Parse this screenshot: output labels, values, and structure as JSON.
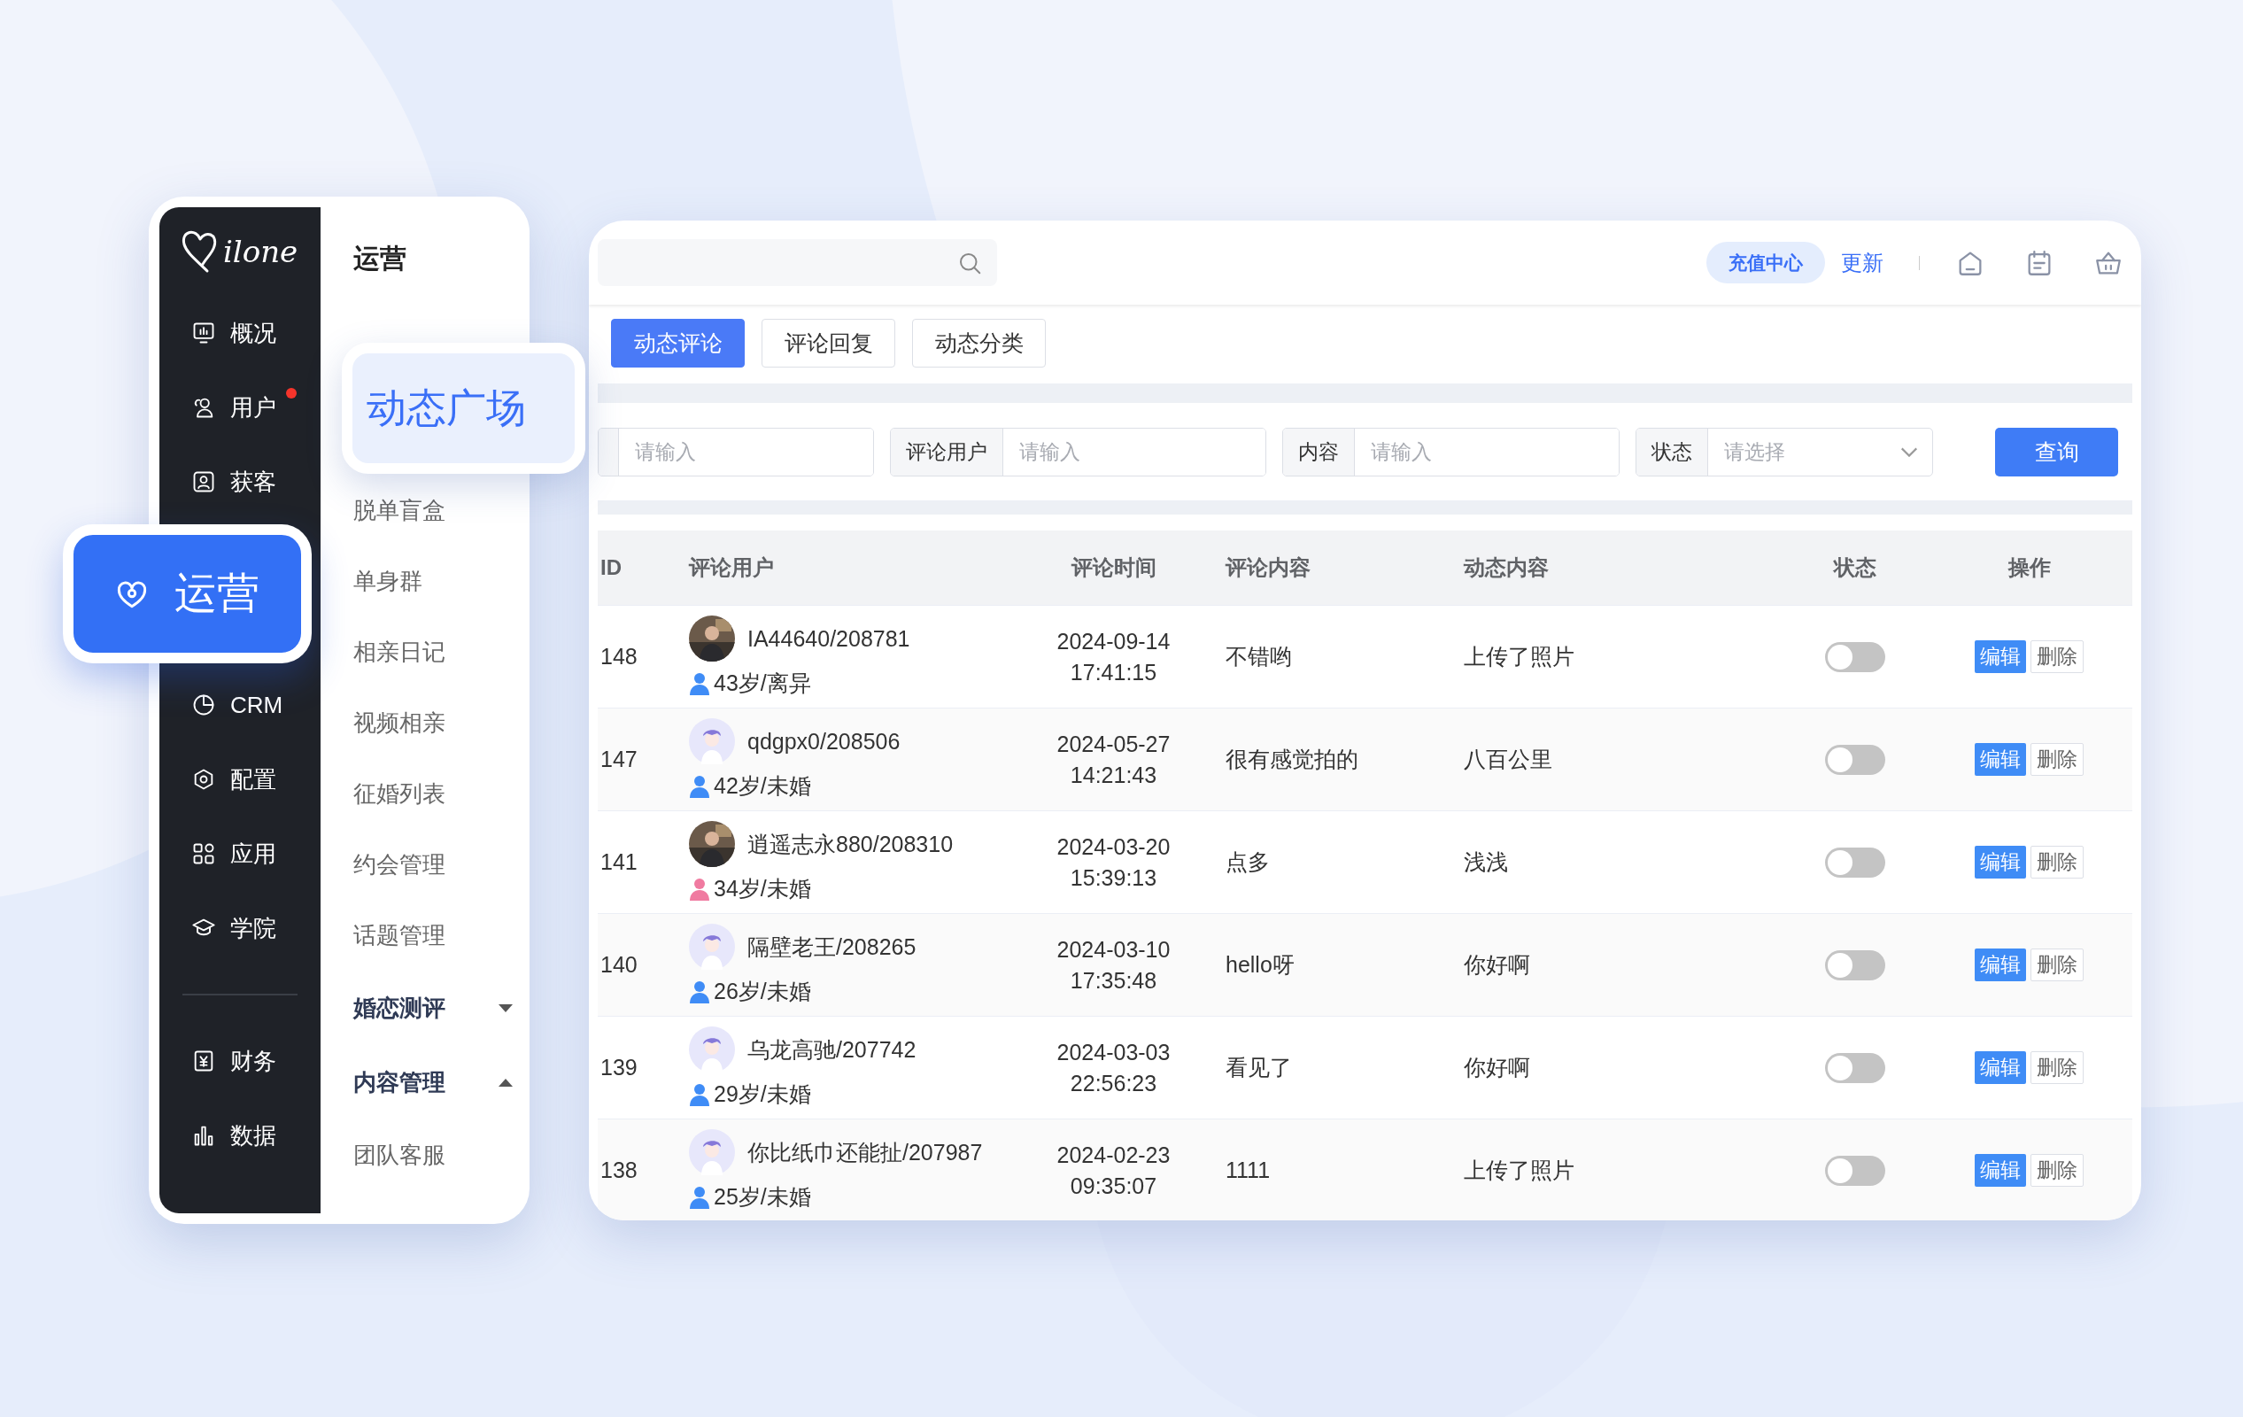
{
  "sidebar": {
    "logo": "ilone",
    "rail_items": [
      {
        "label": "概况",
        "selected": false
      },
      {
        "label": "用户",
        "selected": false,
        "badge": true
      },
      {
        "label": "获客",
        "selected": false
      },
      {
        "label": "运营",
        "selected": true
      },
      {
        "label": "CRM",
        "selected": false
      },
      {
        "label": "配置",
        "selected": false
      },
      {
        "label": "应用",
        "selected": false
      },
      {
        "label": "学院",
        "selected": false
      }
    ],
    "rail_bottom_items": [
      {
        "label": "财务",
        "selected": false
      },
      {
        "label": "数据",
        "selected": false
      }
    ],
    "submenu": {
      "title": "运营",
      "items": [
        {
          "label": "动态广场",
          "selected": true
        },
        {
          "label": "脱单盲盒",
          "selected": false
        },
        {
          "label": "单身群",
          "selected": false
        },
        {
          "label": "相亲日记",
          "selected": false
        },
        {
          "label": "视频相亲",
          "selected": false
        },
        {
          "label": "征婚列表",
          "selected": false
        },
        {
          "label": "约会管理",
          "selected": false
        },
        {
          "label": "话题管理",
          "selected": false
        }
      ],
      "groups": [
        {
          "label": "婚恋测评",
          "expanded": false
        },
        {
          "label": "内容管理",
          "expanded": true,
          "children": [
            {
              "label": "团队客服"
            }
          ]
        }
      ]
    }
  },
  "topbar": {
    "recharge_button": "充值中心",
    "update_link": "更新"
  },
  "tabs": [
    {
      "label": "动态评论",
      "selected": true
    },
    {
      "label": "评论回复",
      "selected": false
    },
    {
      "label": "动态分类",
      "selected": false
    }
  ],
  "filters": [
    {
      "kind": "input",
      "placeholder": "请输入"
    },
    {
      "kind": "input",
      "label": "评论用户",
      "placeholder": "请输入"
    },
    {
      "kind": "input",
      "label": "内容",
      "placeholder": "请输入"
    },
    {
      "kind": "select",
      "label": "状态",
      "placeholder": "请选择"
    }
  ],
  "search_button": "查询",
  "table": {
    "columns": [
      "ID",
      "评论用户",
      "评论时间",
      "评论内容",
      "动态内容",
      "状态",
      "操作"
    ],
    "rows": [
      {
        "id": "148",
        "user": "IA44640/208781",
        "avatar": {
          "kind": "picture"
        },
        "color": "#3f8cf6",
        "profile": "43岁/离异",
        "date": "2024-09-14",
        "time": "17:41:15",
        "comment": "不错哟",
        "post": "上传了照片",
        "on": false,
        "actions": [
          "编辑",
          "删除"
        ]
      },
      {
        "id": "147",
        "user": "qdgpx0/208506",
        "avatar": {
          "kind": "icon"
        },
        "color": "#3f8cf6",
        "profile": "42岁/未婚",
        "date": "2024-05-27",
        "time": "14:21:43",
        "comment": "很有感觉拍的",
        "post": "八百公里",
        "on": false,
        "actions": [
          "编辑",
          "删除"
        ]
      },
      {
        "id": "141",
        "user": "逍遥志永880/208310",
        "avatar": {
          "kind": "picture"
        },
        "color": "#f07aa0",
        "profile": "34岁/未婚",
        "date": "2024-03-20",
        "time": "15:39:13",
        "comment": "点多",
        "post": "浅浅",
        "on": false,
        "actions": [
          "编辑",
          "删除"
        ]
      },
      {
        "id": "140",
        "user": "隔壁老王/208265",
        "avatar": {
          "kind": "icon"
        },
        "color": "#3f8cf6",
        "profile": "26岁/未婚",
        "date": "2024-03-10",
        "time": "17:35:48",
        "comment": "hello呀",
        "post": "你好啊",
        "on": false,
        "actions": [
          "编辑",
          "删除"
        ]
      },
      {
        "id": "139",
        "user": "乌龙高驰/207742",
        "avatar": {
          "kind": "icon"
        },
        "color": "#3f8cf6",
        "profile": "29岁/未婚",
        "date": "2024-03-03",
        "time": "22:56:23",
        "comment": "看见了",
        "post": "你好啊",
        "on": false,
        "actions": [
          "编辑",
          "删除"
        ]
      },
      {
        "id": "138",
        "user": "你比纸巾还能扯/207987",
        "avatar": {
          "kind": "icon"
        },
        "color": "#3f8cf6",
        "profile": "25岁/未婚",
        "date": "2024-02-23",
        "time": "09:35:07",
        "comment": "1111",
        "post": "上传了照片",
        "on": false,
        "actions": [
          "编辑",
          "删除"
        ]
      }
    ]
  }
}
